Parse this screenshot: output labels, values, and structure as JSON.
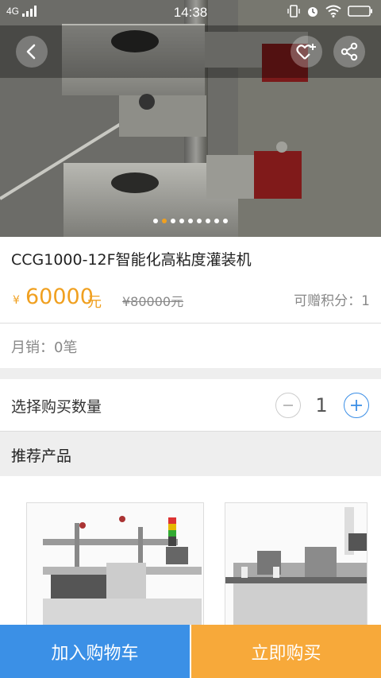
{
  "status_bar": {
    "network": "4G",
    "time": "14:38"
  },
  "product": {
    "title": "CCG1000-12F智能化高粘度灌装机",
    "price_symbol": "¥",
    "price": "60000",
    "price_unit": "元",
    "original_price": "¥80000元",
    "points": "可赠积分：1",
    "monthly_sales": "月销：0笔",
    "image_count": 9,
    "active_image_index": 1
  },
  "quantity": {
    "label": "选择购买数量",
    "minus": "−",
    "value": "1",
    "plus": "+"
  },
  "recommend": {
    "title": "推荐产品"
  },
  "actions": {
    "add_to_cart": "加入购物车",
    "buy_now": "立即购买"
  },
  "colors": {
    "accent_orange": "#f0a020",
    "cart_blue": "#3b90e6",
    "buy_orange": "#f7a93a"
  }
}
